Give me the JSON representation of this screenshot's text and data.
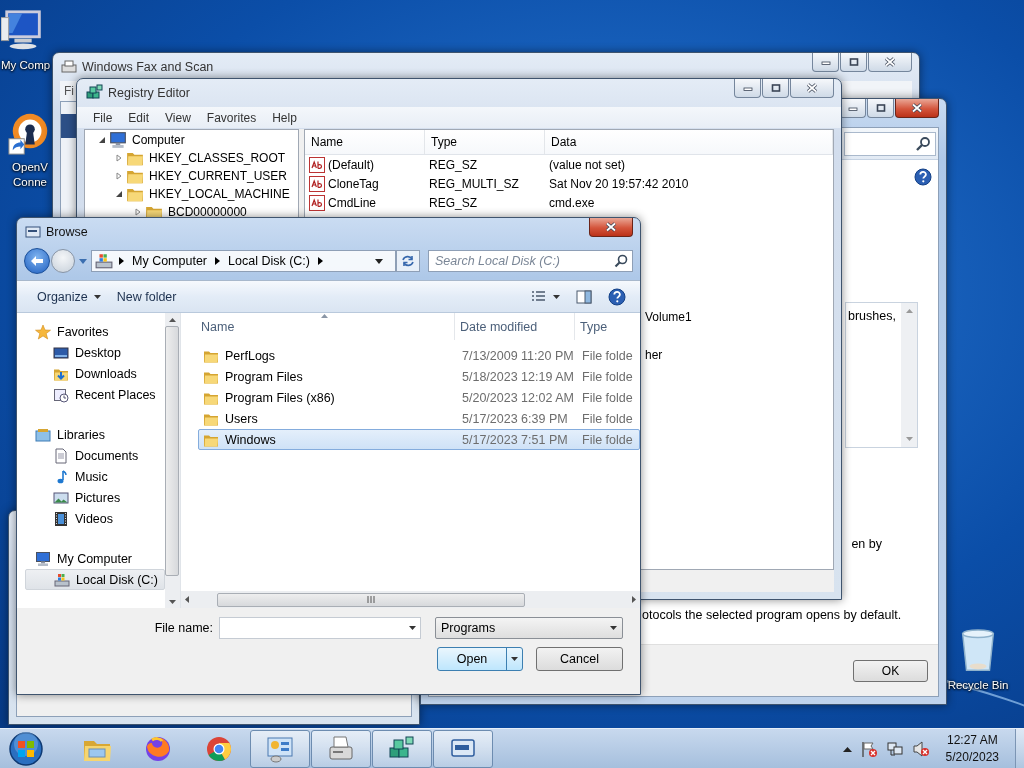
{
  "desktop": {
    "icons": [
      {
        "kind": "computer",
        "label_lines": [
          "My Comp"
        ]
      },
      {
        "kind": "vpn",
        "label_lines": [
          "OpenV",
          "Conne"
        ]
      },
      {
        "kind": "recycle-bin",
        "label_lines": [
          "Recycle Bin"
        ]
      }
    ]
  },
  "fax_window": {
    "title": "Windows Fax and Scan",
    "active": false,
    "menu": [
      "Fi"
    ]
  },
  "defaults_window": {
    "active": true,
    "list_text": "brushes,",
    "line_1": "en by",
    "line_2": "otocols the selected program opens by default.",
    "ok_button": "OK"
  },
  "registry_editor": {
    "title": "Registry Editor",
    "active": false,
    "menu": [
      "File",
      "Edit",
      "View",
      "Favorites",
      "Help"
    ],
    "tree": [
      {
        "label": "Computer",
        "kind": "computer",
        "expanded": true,
        "children": [
          {
            "label": "HKEY_CLASSES_ROOT",
            "kind": "folder",
            "expanded": false
          },
          {
            "label": "HKEY_CURRENT_USER",
            "kind": "folder",
            "expanded": false
          },
          {
            "label": "HKEY_LOCAL_MACHINE",
            "kind": "folder",
            "expanded": true,
            "children": [
              {
                "label": "BCD00000000",
                "kind": "folder",
                "expanded": false
              }
            ]
          }
        ]
      }
    ],
    "columns": [
      "Name",
      "Type",
      "Data"
    ],
    "rows": [
      {
        "name": "(Default)",
        "type": "REG_SZ",
        "data": "(value not set)"
      },
      {
        "name": "CloneTag",
        "type": "REG_MULTI_SZ",
        "data": "Sat Nov 20 19:57:42 2010"
      },
      {
        "name": "CmdLine",
        "type": "REG_SZ",
        "data": "cmd.exe"
      }
    ],
    "partial_data": [
      "Volume1",
      "her"
    ]
  },
  "browse_dialog": {
    "title": "Browse",
    "active": true,
    "breadcrumbs": [
      "My Computer",
      "Local Disk (C:)"
    ],
    "search": {
      "placeholder": "Search Local Disk (C:)"
    },
    "toolbar": {
      "organize": "Organize",
      "new_folder": "New folder"
    },
    "nav": [
      {
        "label": "Favorites",
        "kind": "star",
        "selected": false,
        "children": [
          {
            "label": "Desktop",
            "kind": "desktop",
            "selected": false
          },
          {
            "label": "Downloads",
            "kind": "downloads",
            "selected": false
          },
          {
            "label": "Recent Places",
            "kind": "recent",
            "selected": false
          }
        ]
      },
      {
        "label": "Libraries",
        "kind": "libraries",
        "selected": false,
        "children": [
          {
            "label": "Documents",
            "kind": "documents",
            "selected": false
          },
          {
            "label": "Music",
            "kind": "music",
            "selected": false
          },
          {
            "label": "Pictures",
            "kind": "pictures",
            "selected": false
          },
          {
            "label": "Videos",
            "kind": "videos",
            "selected": false
          }
        ]
      },
      {
        "label": "My Computer",
        "kind": "computer",
        "selected": false,
        "children": [
          {
            "label": "Local Disk (C:)",
            "kind": "drive",
            "selected": true
          }
        ]
      }
    ],
    "columns": [
      "Name",
      "Date modified",
      "Type"
    ],
    "files": [
      {
        "name": "PerfLogs",
        "date": "7/13/2009 11:20 PM",
        "type": "File folde",
        "selected": false
      },
      {
        "name": "Program Files",
        "date": "5/18/2023 12:19 AM",
        "type": "File folde",
        "selected": false
      },
      {
        "name": "Program Files (x86)",
        "date": "5/20/2023 12:02 AM",
        "type": "File folde",
        "selected": false
      },
      {
        "name": "Users",
        "date": "5/17/2023 6:39 PM",
        "type": "File folde",
        "selected": false
      },
      {
        "name": "Windows",
        "date": "5/17/2023 7:51 PM",
        "type": "File folde",
        "selected": true
      }
    ],
    "file_name": {
      "label": "File name:"
    },
    "file_type": "Programs",
    "open_button": "Open",
    "cancel_button": "Cancel"
  },
  "taskbar": {
    "items": [
      {
        "kind": "folder",
        "running": false
      },
      {
        "kind": "firefox",
        "running": false
      },
      {
        "kind": "chrome",
        "running": false
      },
      {
        "kind": "control-panel",
        "running": true
      },
      {
        "kind": "fax",
        "running": true
      },
      {
        "kind": "registry",
        "running": true
      },
      {
        "kind": "remote",
        "running": true
      }
    ],
    "clock": {
      "time": "12:27 AM",
      "date": "5/20/2023"
    }
  }
}
